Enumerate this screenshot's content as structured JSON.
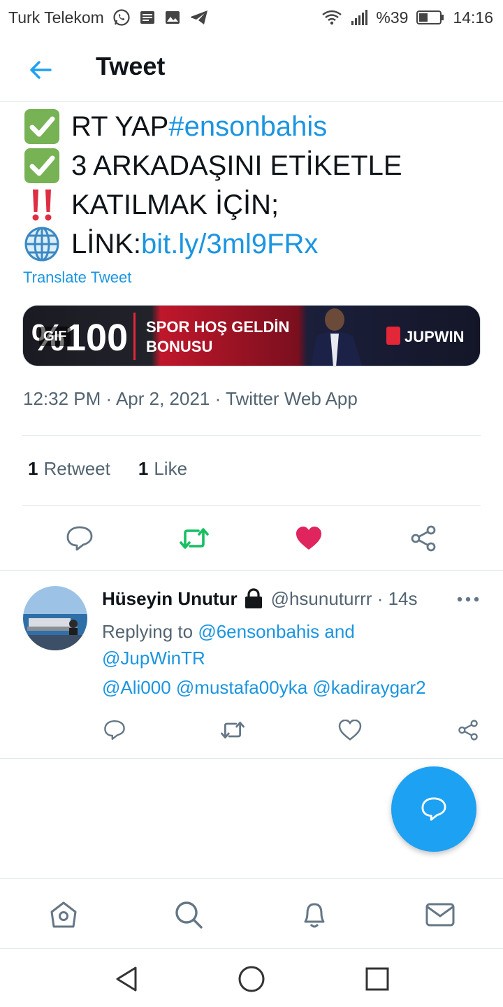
{
  "status_bar": {
    "carrier": "Turk Telekom",
    "battery": "%39",
    "time": "14:16",
    "icons": [
      "whatsapp-icon",
      "news-icon",
      "image-icon",
      "telegram-icon",
      "wifi-icon",
      "signal-icon",
      "battery-icon"
    ]
  },
  "header": {
    "title": "Tweet",
    "back_icon": "arrow-left-icon"
  },
  "tweet": {
    "lines": [
      {
        "emoji": "check-mark-icon",
        "text": "RT YAP ",
        "link": "#ensonbahis"
      },
      {
        "emoji": "check-mark-icon",
        "text": "3 ARKADAŞINI ETİKETLE",
        "link": ""
      },
      {
        "emoji": "double-exclamation-icon",
        "text": "KATILMAK İÇİN;",
        "link": ""
      },
      {
        "emoji": "globe-icon",
        "text": "LİNK: ",
        "link": "bit.ly/3ml9FRx"
      }
    ],
    "translate_label": "Translate Tweet",
    "media": {
      "badge": "GIF",
      "banner_amount": "%100",
      "banner_line1": "SPOR HOŞ GELDİN",
      "banner_line2": "BONUSU",
      "banner_brand": "JUPWIN"
    },
    "meta": "12:32 PM · Apr 2, 2021 · Twitter Web App",
    "stats": {
      "retweets_count": "1",
      "retweets_label": "Retweet",
      "likes_count": "1",
      "likes_label": "Like"
    },
    "actions": [
      "reply-icon",
      "retweet-icon",
      "like-icon",
      "share-icon"
    ],
    "colors": {
      "link": "#1b95e0",
      "retweet_active": "#17bf63",
      "like_active": "#e0245e"
    }
  },
  "reply": {
    "name": "Hüseyin Unutur",
    "handle_time": "@hsunuturrr · 14s",
    "replying_prefix": "Replying to ",
    "replying_to_1": "@6ensonbahis",
    "replying_and": " and",
    "replying_to_2": "@JupWinTR",
    "mentions": "@Ali000 @mustafa00yka @kadiraygar2",
    "more_icon": "more-icon",
    "actions": [
      "reply-icon",
      "retweet-icon",
      "like-icon",
      "share-icon"
    ]
  },
  "fab": {
    "icon": "compose-reply-icon",
    "color": "#1da1f2"
  },
  "bottom_nav": [
    "home-icon",
    "search-icon",
    "notifications-icon",
    "messages-icon"
  ],
  "system_nav": [
    "back-triangle-icon",
    "home-circle-icon",
    "recents-square-icon"
  ]
}
